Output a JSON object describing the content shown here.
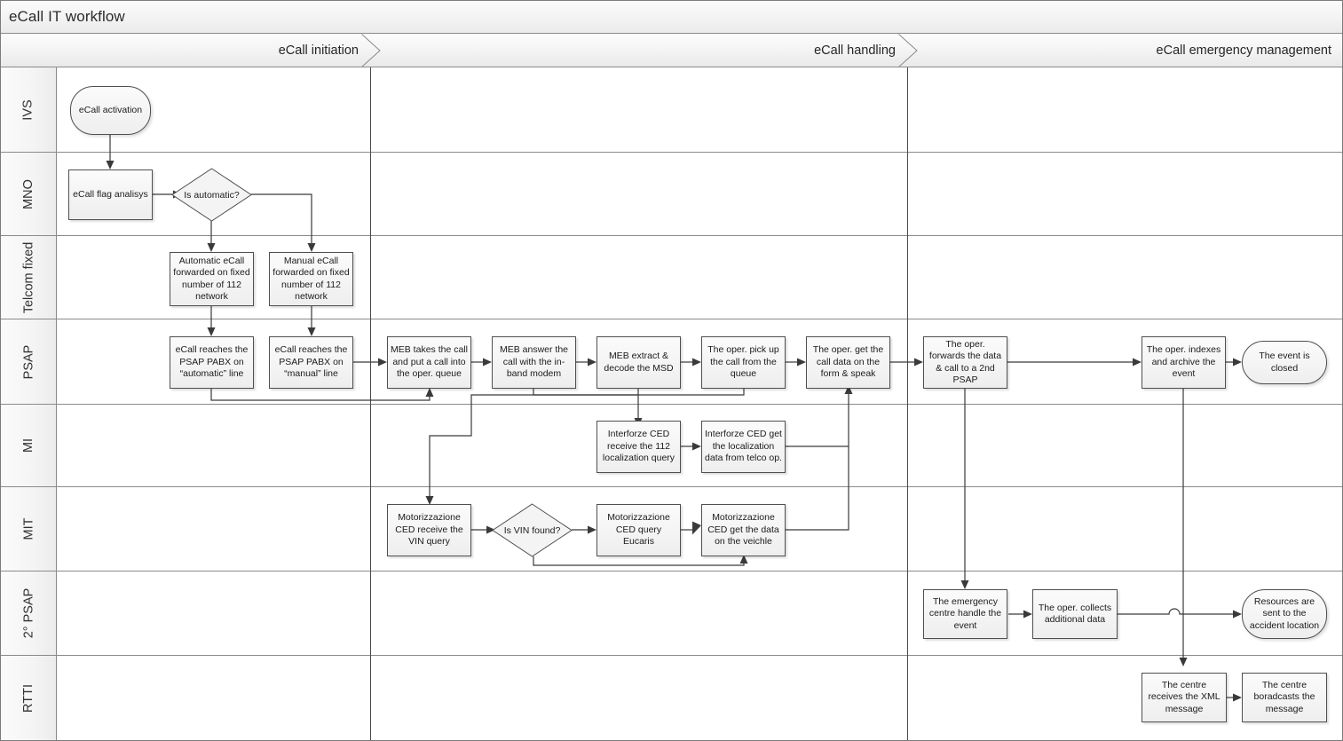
{
  "header": {
    "title": "eCall IT workflow"
  },
  "phases": [
    {
      "label": "eCall initiation"
    },
    {
      "label": "eCall handling"
    },
    {
      "label": "eCall emergency management"
    }
  ],
  "lanes": [
    {
      "label": "IVS"
    },
    {
      "label": "MNO"
    },
    {
      "label": "Telcom fixed"
    },
    {
      "label": "PSAP"
    },
    {
      "label": "MI"
    },
    {
      "label": "MIT"
    },
    {
      "label": "2° PSAP"
    },
    {
      "label": "RTTI"
    }
  ],
  "nodes": {
    "ecall_activation": "eCall activation",
    "ecall_flag_analisys": "eCall flag analisys",
    "is_automatic": "Is automatic?",
    "automatic_forward": "Automatic eCall forwarded on fixed number of 112 network",
    "manual_forward": "Manual eCall forwarded on fixed number of 112 network",
    "pabx_automatic": "eCall reaches the PSAP PABX on “automatic” line",
    "pabx_manual": "eCall reaches the PSAP PABX on “manual” line",
    "meb_takes_call": "MEB takes the call and put a call into the oper. queue",
    "meb_answer_call": "MEB answer the call with the in-band modem",
    "meb_extract_msd": "MEB extract & decode the MSD",
    "oper_pick_up": "The oper. pick up the call from the queue",
    "oper_get_data": "The oper. get the call data on the form & speak",
    "oper_forwards": "The oper. forwards the data & call to a 2nd PSAP",
    "oper_indexes": "The oper. indexes and archive the event",
    "event_closed": "The event is closed",
    "interforze_receive": "Interforze CED receive the 112 localization query",
    "interforze_get": "Interforze CED get the localization data from telco op.",
    "motor_receive_vin": "Motorizzazione CED receive the VIN query",
    "is_vin_found": "Is VIN found?",
    "motor_query_eucaris": "Motorizzazione CED query Eucaris",
    "motor_get_data": "Motorizzazione CED get the data on the veichle",
    "emergency_centre": "The emergency centre handle the event",
    "oper_collects": "The oper. collects additional data",
    "resources_sent": "Resources are sent to the accident location",
    "centre_receives_xml": "The centre receives the XML message",
    "centre_broadcasts": "The centre boradcasts the message"
  },
  "colors": {
    "node_fill": "#f4f4f4",
    "node_border": "#4f4f4f",
    "lane_header_fill": "#f2f2f2",
    "grid_line": "#8a8a8a",
    "connector": "#3a3a3a"
  }
}
